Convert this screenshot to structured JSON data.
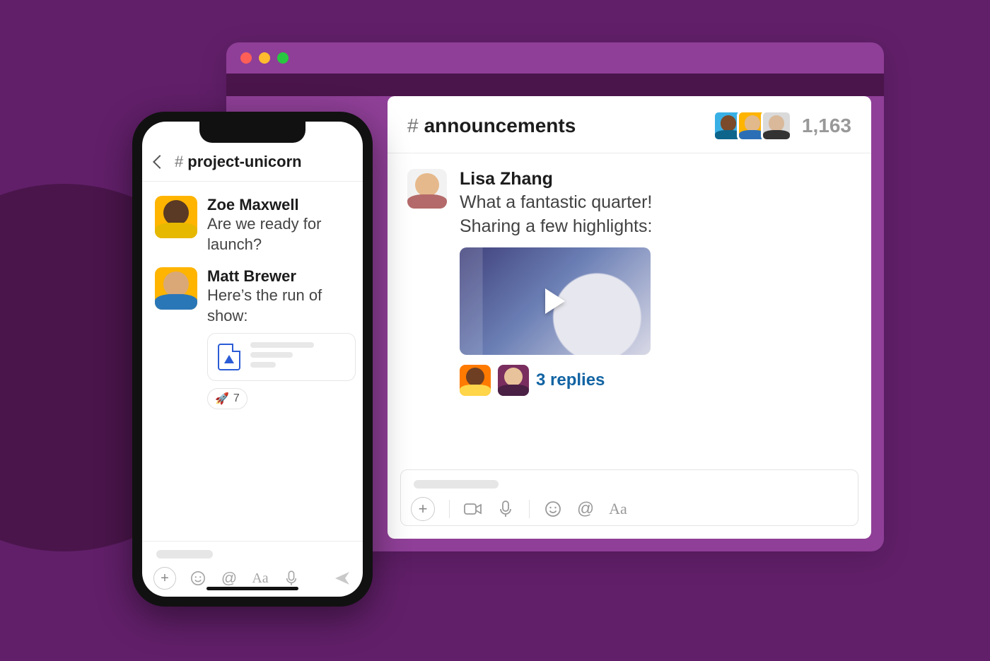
{
  "desktop": {
    "hash": "#",
    "channel": "announcements",
    "member_count": "1,163",
    "message": {
      "author": "Lisa Zhang",
      "line1": "What a fantastic quarter!",
      "line2": "Sharing a few highlights:",
      "replies_label": "3 replies"
    }
  },
  "phone": {
    "hash": "#",
    "channel": "project-unicorn",
    "messages": [
      {
        "author": "Zoe Maxwell",
        "text": "Are we ready for launch?"
      },
      {
        "author": "Matt Brewer",
        "text": "Here’s the run of show:"
      }
    ],
    "reaction": {
      "emoji": "🚀",
      "count": "7"
    }
  }
}
